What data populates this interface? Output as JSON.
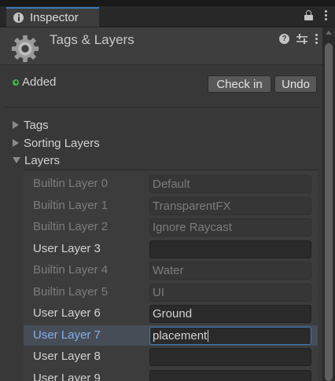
{
  "window": {
    "tab_title": "Inspector"
  },
  "header": {
    "title": "Tags & Layers"
  },
  "status": {
    "label": "Added",
    "color": "#3dbf4a"
  },
  "buttons": {
    "check_in": "Check in",
    "undo": "Undo"
  },
  "foldouts": {
    "tags": "Tags",
    "sorting_layers": "Sorting Layers",
    "layers": "Layers"
  },
  "layers": [
    {
      "name": "Builtin Layer 0",
      "value": "Default",
      "editable": false
    },
    {
      "name": "Builtin Layer 1",
      "value": "TransparentFX",
      "editable": false
    },
    {
      "name": "Builtin Layer 2",
      "value": "Ignore Raycast",
      "editable": false
    },
    {
      "name": "User Layer 3",
      "value": "",
      "editable": true
    },
    {
      "name": "Builtin Layer 4",
      "value": "Water",
      "editable": false
    },
    {
      "name": "Builtin Layer 5",
      "value": "UI",
      "editable": false
    },
    {
      "name": "User Layer 6",
      "value": "Ground",
      "editable": true
    },
    {
      "name": "User Layer 7",
      "value": "placement",
      "editable": true,
      "selected": true
    },
    {
      "name": "User Layer 8",
      "value": "",
      "editable": true
    },
    {
      "name": "User Layer 9",
      "value": "",
      "editable": true
    }
  ],
  "accent_color": "#3a79bb"
}
